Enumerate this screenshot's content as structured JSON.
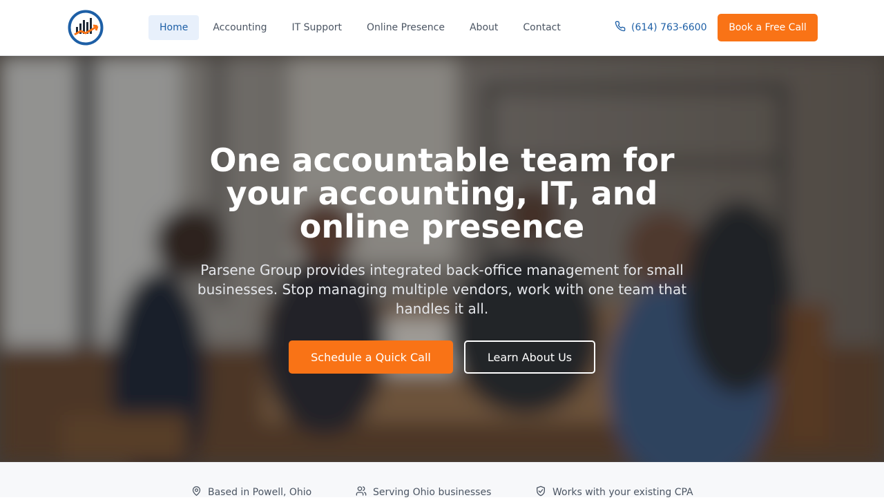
{
  "header": {
    "nav": [
      {
        "label": "Home",
        "active": true
      },
      {
        "label": "Accounting",
        "active": false
      },
      {
        "label": "IT Support",
        "active": false
      },
      {
        "label": "Online Presence",
        "active": false
      },
      {
        "label": "About",
        "active": false
      },
      {
        "label": "Contact",
        "active": false
      }
    ],
    "phone": "(614) 763-6600",
    "cta": "Book a Free Call"
  },
  "hero": {
    "title_lines": [
      "One accountable team for",
      "your accounting, IT, and",
      "online presence"
    ],
    "subtitle": "Parsene Group provides integrated back-office management for small businesses. Stop managing multiple vendors, work with one team that handles it all.",
    "primary_cta": "Schedule a Quick Call",
    "secondary_cta": "Learn About Us"
  },
  "trust": [
    {
      "icon": "map-pin-icon",
      "label": "Based in Powell, Ohio"
    },
    {
      "icon": "users-icon",
      "label": "Serving Ohio businesses"
    },
    {
      "icon": "handshake-icon",
      "label": "Works with your existing CPA"
    }
  ],
  "colors": {
    "accent": "#f97316",
    "brand_blue": "#1d5fa6"
  }
}
